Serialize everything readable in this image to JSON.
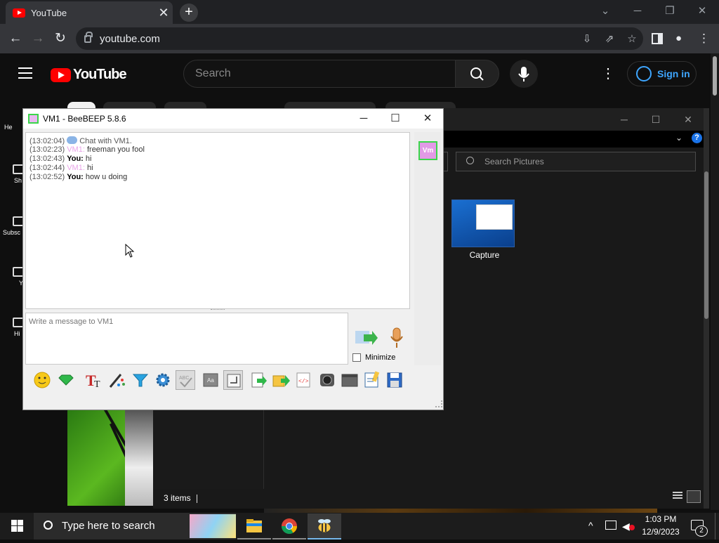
{
  "browser": {
    "tab_title": "YouTube",
    "tab_close": "✕",
    "new_tab": "+",
    "url": "youtube.com",
    "win_controls": [
      "⌄",
      "─",
      "❐",
      "✕"
    ]
  },
  "youtube": {
    "search_placeholder": "Search",
    "logo_text": "YouTube",
    "signin_label": "Sign in",
    "more_glyph": "⋮",
    "sidenav_labels": [
      "He",
      "Sh",
      "Subsc",
      "Y",
      "Hi"
    ]
  },
  "explorer": {
    "search_placeholder": "Search Pictures",
    "file_name": "Capture",
    "status_items": "3 items",
    "help": "?",
    "chevron": "⌄",
    "controls": [
      "─",
      "☐",
      "✕"
    ]
  },
  "beebeep": {
    "title": "VM1 - BeeBEEP 5.8.6",
    "controls": [
      "─",
      "☐",
      "✕"
    ],
    "avatar": "Vm",
    "messages": [
      {
        "ts": "(13:02:04)",
        "who": "",
        "text": "Chat with VM1.",
        "kind": "system"
      },
      {
        "ts": "(13:02:23)",
        "who": "VM1:",
        "text": "freeman you fool",
        "kind": "peer"
      },
      {
        "ts": "(13:02:43)",
        "who": "You:",
        "text": "hi",
        "kind": "self"
      },
      {
        "ts": "(13:02:44)",
        "who": "VM1:",
        "text": "hi",
        "kind": "peer"
      },
      {
        "ts": "(13:02:52)",
        "who": "You:",
        "text": "how u doing",
        "kind": "self"
      }
    ],
    "input_placeholder": "Write a message to VM1",
    "minimize_label": "Minimize",
    "toolbar_icons": [
      "emoticon-icon",
      "gem-icon",
      "font-icon",
      "color-picker-icon",
      "filter-icon",
      "settings-icon",
      "spellcheck-icon",
      "dictionary-icon",
      "enter-key-icon",
      "save-chat-icon",
      "send-file-icon",
      "html-icon",
      "screenshot-icon",
      "terminal-icon",
      "notes-icon",
      "save-icon"
    ]
  },
  "taskbar": {
    "search_placeholder": "Type here to search",
    "time": "1:03 PM",
    "date": "12/9/2023",
    "notifications": "2",
    "tray_chevron": "^"
  }
}
